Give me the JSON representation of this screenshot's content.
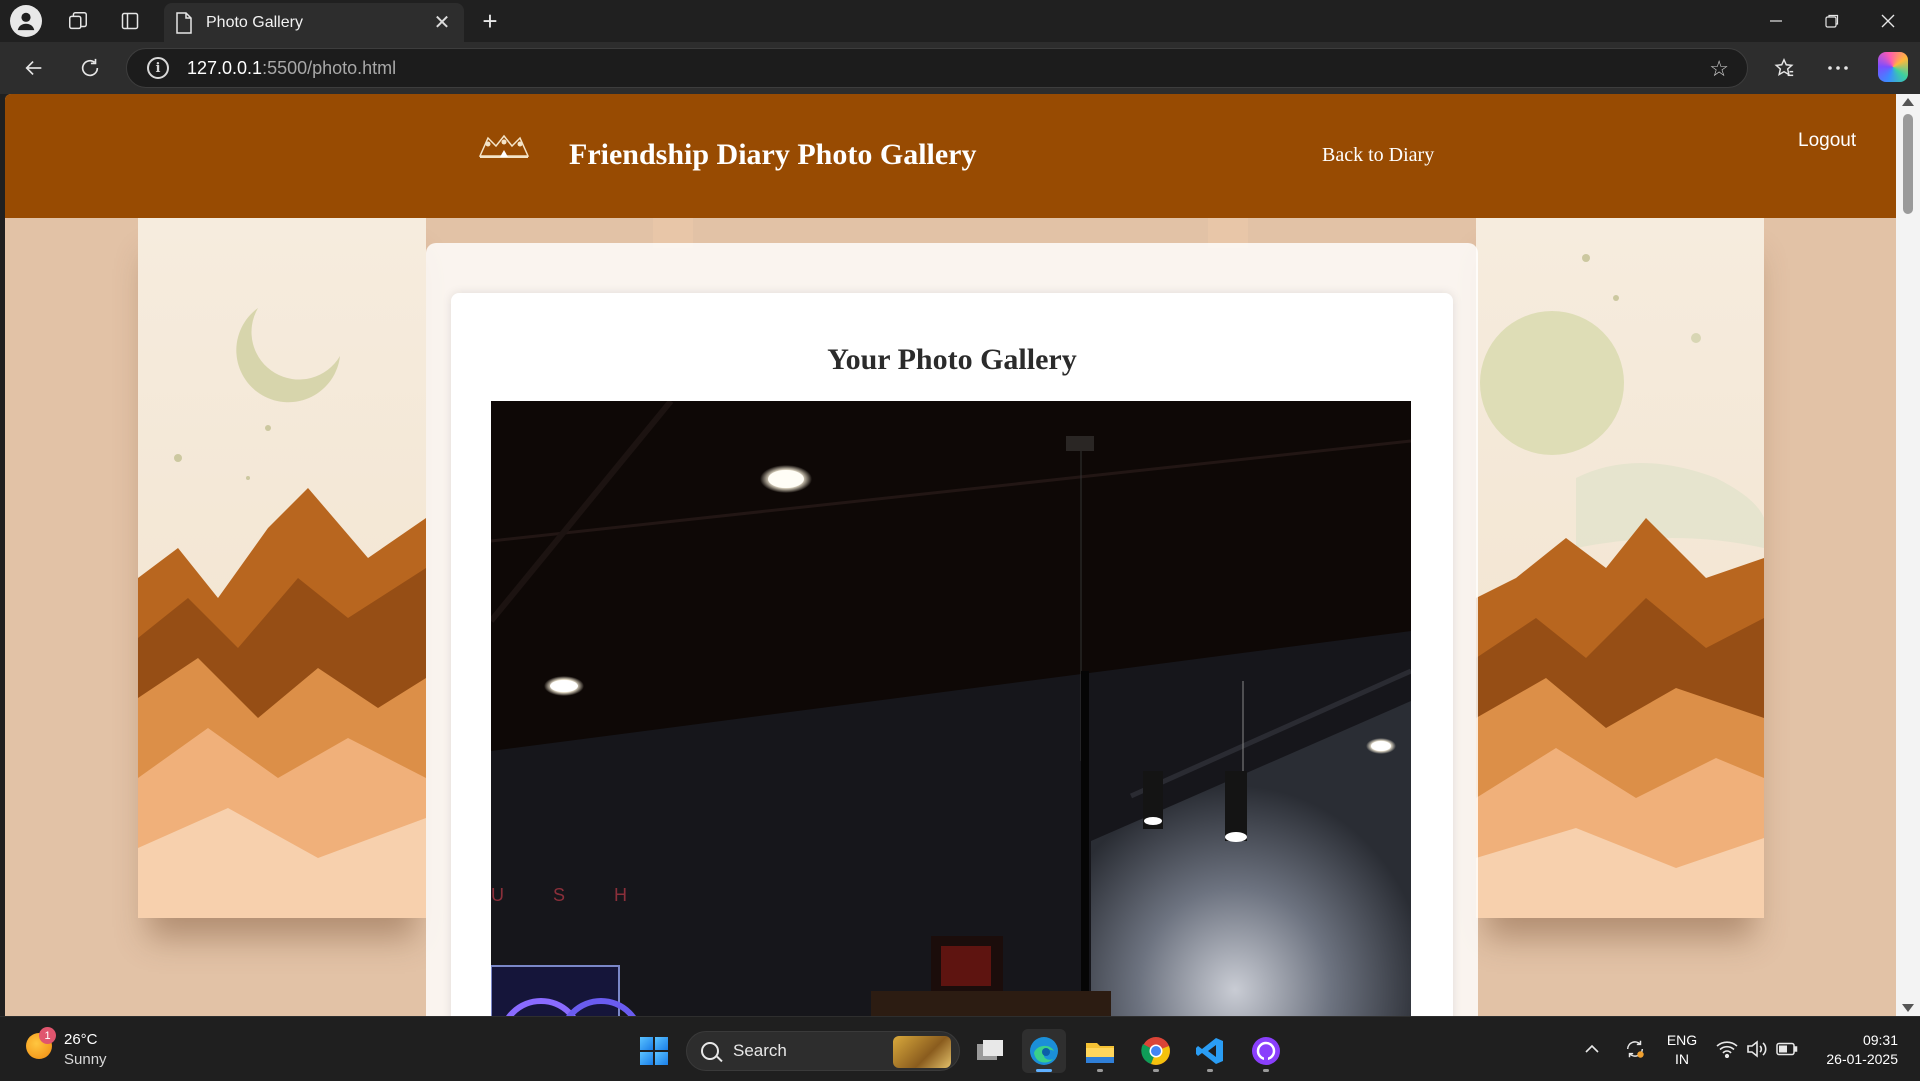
{
  "browser": {
    "tab_title": "Photo Gallery",
    "url_host": "127.0.0.1",
    "url_path": ":5500/photo.html"
  },
  "header": {
    "title": "Friendship Diary Photo Gallery",
    "back_link": "Back to Diary",
    "logout": "Logout",
    "background_color": "#984b02"
  },
  "main": {
    "heading": "Your Photo Gallery",
    "photo_sign_text": "U S H"
  },
  "taskbar": {
    "weather_badge": "1",
    "weather_temp": "26°C",
    "weather_desc": "Sunny",
    "search_label": "Search",
    "lang_line1": "ENG",
    "lang_line2": "IN",
    "time": "09:31",
    "date": "26-01-2025"
  }
}
